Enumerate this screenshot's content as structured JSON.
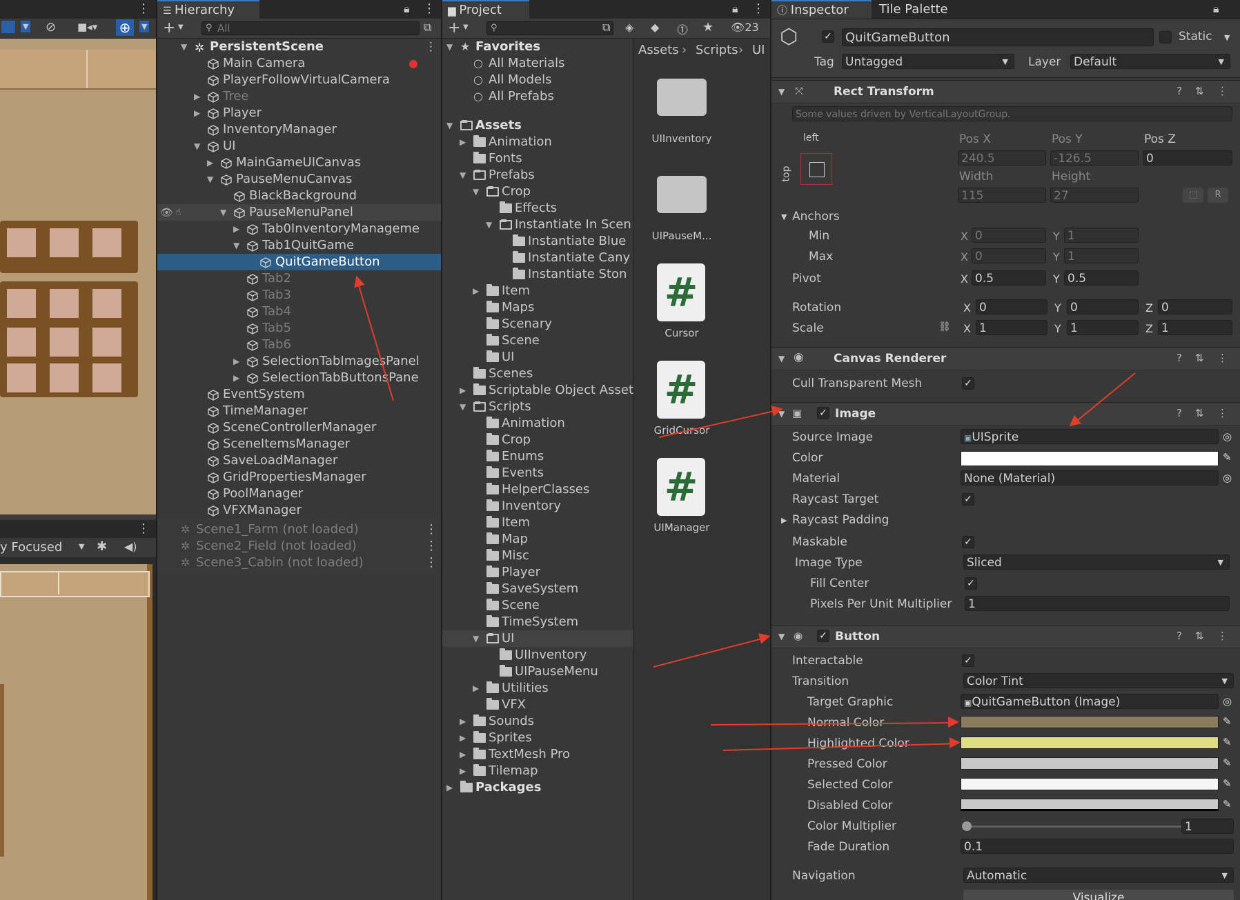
{
  "hierarchy": {
    "tab": "Hierarchy",
    "search_placeholder": "All",
    "rows": [
      {
        "label": "PersistentScene",
        "bold": true,
        "indent": 0,
        "arrow": "▼",
        "icon": "scene"
      },
      {
        "label": "Main Camera",
        "indent": 1,
        "icon": "cube"
      },
      {
        "label": "PlayerFollowVirtualCamera",
        "indent": 1,
        "icon": "cube"
      },
      {
        "label": "Tree",
        "indent": 1,
        "arrow": "▶",
        "icon": "cube",
        "dim": true
      },
      {
        "label": "Player",
        "indent": 1,
        "arrow": "▶",
        "icon": "cube"
      },
      {
        "label": "InventoryManager",
        "indent": 1,
        "icon": "cube"
      },
      {
        "label": "UI",
        "indent": 1,
        "arrow": "▼",
        "icon": "cube"
      },
      {
        "label": "MainGameUICanvas",
        "indent": 2,
        "arrow": "▶",
        "icon": "cube"
      },
      {
        "label": "PauseMenuCanvas",
        "indent": 2,
        "arrow": "▼",
        "icon": "cube"
      },
      {
        "label": "BlackBackground",
        "indent": 3,
        "icon": "cube"
      },
      {
        "label": "PauseMenuPanel",
        "indent": 3,
        "arrow": "▼",
        "icon": "cube",
        "hover": true
      },
      {
        "label": "Tab0InventoryManageme",
        "indent": 4,
        "arrow": "▶",
        "icon": "cube"
      },
      {
        "label": "Tab1QuitGame",
        "indent": 4,
        "arrow": "▼",
        "icon": "cube"
      },
      {
        "label": "QuitGameButton",
        "indent": 5,
        "icon": "cube",
        "selected": true
      },
      {
        "label": "Tab2",
        "indent": 4,
        "icon": "cube",
        "dim": true
      },
      {
        "label": "Tab3",
        "indent": 4,
        "icon": "cube",
        "dim": true
      },
      {
        "label": "Tab4",
        "indent": 4,
        "icon": "cube",
        "dim": true
      },
      {
        "label": "Tab5",
        "indent": 4,
        "icon": "cube",
        "dim": true
      },
      {
        "label": "Tab6",
        "indent": 4,
        "icon": "cube",
        "dim": true
      },
      {
        "label": "SelectionTabImagesPanel",
        "indent": 4,
        "arrow": "▶",
        "icon": "cube"
      },
      {
        "label": "SelectionTabButtonsPane",
        "indent": 4,
        "arrow": "▶",
        "icon": "cube"
      },
      {
        "label": "EventSystem",
        "indent": 1,
        "icon": "cube"
      },
      {
        "label": "TimeManager",
        "indent": 1,
        "icon": "cube"
      },
      {
        "label": "SceneControllerManager",
        "indent": 1,
        "icon": "cube"
      },
      {
        "label": "SceneItemsManager",
        "indent": 1,
        "icon": "cube"
      },
      {
        "label": "SaveLoadManager",
        "indent": 1,
        "icon": "cube"
      },
      {
        "label": "GridPropertiesManager",
        "indent": 1,
        "icon": "cube"
      },
      {
        "label": "PoolManager",
        "indent": 1,
        "icon": "cube"
      },
      {
        "label": "VFXManager",
        "indent": 1,
        "icon": "cube"
      }
    ],
    "unloaded": [
      "Scene1_Farm (not loaded)",
      "Scene2_Field (not loaded)",
      "Scene3_Cabin (not loaded)"
    ]
  },
  "game_view": {
    "focus_label": "y Focused"
  },
  "project": {
    "tab": "Project",
    "count": "23",
    "breadcrumb": [
      "Assets",
      "Scripts",
      "UI"
    ],
    "tree": [
      {
        "label": "Favorites",
        "bold": true,
        "indent": 0,
        "arrow": "▼",
        "icon": "star"
      },
      {
        "label": "All Materials",
        "indent": 1,
        "icon": "search"
      },
      {
        "label": "All Models",
        "indent": 1,
        "icon": "search"
      },
      {
        "label": "All Prefabs",
        "indent": 1,
        "icon": "search"
      },
      {
        "label": "",
        "indent": 0,
        "icon": "none"
      },
      {
        "label": "Assets",
        "bold": true,
        "indent": 0,
        "arrow": "▼",
        "icon": "folder-open"
      },
      {
        "label": "Animation",
        "indent": 1,
        "arrow": "▶",
        "icon": "folder"
      },
      {
        "label": "Fonts",
        "indent": 1,
        "icon": "folder"
      },
      {
        "label": "Prefabs",
        "indent": 1,
        "arrow": "▼",
        "icon": "folder-open"
      },
      {
        "label": "Crop",
        "indent": 2,
        "arrow": "▼",
        "icon": "folder-open"
      },
      {
        "label": "Effects",
        "indent": 3,
        "icon": "folder"
      },
      {
        "label": "Instantiate In Scen",
        "indent": 3,
        "arrow": "▼",
        "icon": "folder-open"
      },
      {
        "label": "Instantiate Blue",
        "indent": 4,
        "icon": "folder"
      },
      {
        "label": "Instantiate Cany",
        "indent": 4,
        "icon": "folder"
      },
      {
        "label": "Instantiate Ston",
        "indent": 4,
        "icon": "folder"
      },
      {
        "label": "Item",
        "indent": 2,
        "arrow": "▶",
        "icon": "folder"
      },
      {
        "label": "Maps",
        "indent": 2,
        "icon": "folder"
      },
      {
        "label": "Scenary",
        "indent": 2,
        "icon": "folder"
      },
      {
        "label": "Scene",
        "indent": 2,
        "icon": "folder"
      },
      {
        "label": "UI",
        "indent": 2,
        "icon": "folder"
      },
      {
        "label": "Scenes",
        "indent": 1,
        "icon": "folder"
      },
      {
        "label": "Scriptable Object Asset",
        "indent": 1,
        "arrow": "▶",
        "icon": "folder"
      },
      {
        "label": "Scripts",
        "indent": 1,
        "arrow": "▼",
        "icon": "folder-open"
      },
      {
        "label": "Animation",
        "indent": 2,
        "icon": "folder"
      },
      {
        "label": "Crop",
        "indent": 2,
        "icon": "folder"
      },
      {
        "label": "Enums",
        "indent": 2,
        "icon": "folder"
      },
      {
        "label": "Events",
        "indent": 2,
        "icon": "folder"
      },
      {
        "label": "HelperClasses",
        "indent": 2,
        "icon": "folder"
      },
      {
        "label": "Inventory",
        "indent": 2,
        "icon": "folder"
      },
      {
        "label": "Item",
        "indent": 2,
        "icon": "folder"
      },
      {
        "label": "Map",
        "indent": 2,
        "icon": "folder"
      },
      {
        "label": "Misc",
        "indent": 2,
        "icon": "folder"
      },
      {
        "label": "Player",
        "indent": 2,
        "icon": "folder"
      },
      {
        "label": "SaveSystem",
        "indent": 2,
        "icon": "folder"
      },
      {
        "label": "Scene",
        "indent": 2,
        "icon": "folder"
      },
      {
        "label": "TimeSystem",
        "indent": 2,
        "icon": "folder"
      },
      {
        "label": "UI",
        "indent": 2,
        "arrow": "▼",
        "icon": "folder-open",
        "hover": true
      },
      {
        "label": "UIInventory",
        "indent": 3,
        "icon": "folder"
      },
      {
        "label": "UIPauseMenu",
        "indent": 3,
        "icon": "folder"
      },
      {
        "label": "Utilities",
        "indent": 2,
        "arrow": "▶",
        "icon": "folder"
      },
      {
        "label": "VFX",
        "indent": 2,
        "icon": "folder"
      },
      {
        "label": "Sounds",
        "indent": 1,
        "arrow": "▶",
        "icon": "folder"
      },
      {
        "label": "Sprites",
        "indent": 1,
        "arrow": "▶",
        "icon": "folder"
      },
      {
        "label": "TextMesh Pro",
        "indent": 1,
        "arrow": "▶",
        "icon": "folder"
      },
      {
        "label": "Tilemap",
        "indent": 1,
        "arrow": "▶",
        "icon": "folder"
      },
      {
        "label": "Packages",
        "bold": true,
        "indent": 0,
        "arrow": "▶",
        "icon": "folder"
      }
    ],
    "assets": [
      {
        "label": "UIInventory",
        "kind": "folder"
      },
      {
        "label": "UIPauseM...",
        "kind": "folder"
      },
      {
        "label": "Cursor",
        "kind": "script"
      },
      {
        "label": "GridCursor",
        "kind": "script"
      },
      {
        "label": "UIManager",
        "kind": "script"
      }
    ]
  },
  "inspector": {
    "tab": "Inspector",
    "tab2": "Tile Palette",
    "object_name": "QuitGameButton",
    "static_label": "Static",
    "tag_label": "Tag",
    "tag_value": "Untagged",
    "layer_label": "Layer",
    "layer_value": "Default",
    "rect": {
      "title": "Rect Transform",
      "note": "Some values driven by VerticalLayoutGroup.",
      "left": "left",
      "top": "top",
      "posx_label": "Pos X",
      "posy_label": "Pos Y",
      "posz_label": "Pos Z",
      "posx": "240.5",
      "posy": "-126.5",
      "posz": "0",
      "width_label": "Width",
      "height_label": "Height",
      "width": "115",
      "height": "27",
      "anchors_label": "Anchors",
      "min_label": "Min",
      "max_label": "Max",
      "min_x": "0",
      "min_y": "1",
      "max_x": "0",
      "max_y": "1",
      "pivot_label": "Pivot",
      "pivot_x": "0.5",
      "pivot_y": "0.5",
      "rotation_label": "Rotation",
      "rot_x": "0",
      "rot_y": "0",
      "rot_z": "0",
      "scale_label": "Scale",
      "scale_x": "1",
      "scale_y": "1",
      "scale_z": "1",
      "x": "X",
      "y": "Y",
      "z": "Z",
      "r": "R"
    },
    "canvas_renderer": {
      "title": "Canvas Renderer",
      "cull_label": "Cull Transparent Mesh"
    },
    "image": {
      "title": "Image",
      "source_label": "Source Image",
      "source_value": "UISprite",
      "color_label": "Color",
      "color": "#ffffff",
      "material_label": "Material",
      "material_value": "None (Material)",
      "raycast_label": "Raycast Target",
      "padding_label": "Raycast Padding",
      "maskable_label": "Maskable",
      "type_label": "Image Type",
      "type_value": "Sliced",
      "fill_label": "Fill Center",
      "ppu_label": "Pixels Per Unit Multiplier",
      "ppu_value": "1"
    },
    "button": {
      "title": "Button",
      "interactable_label": "Interactable",
      "transition_label": "Transition",
      "transition_value": "Color Tint",
      "target_label": "Target Graphic",
      "target_value": "QuitGameButton (Image)",
      "normal_label": "Normal Color",
      "normal": "#8c7c5e",
      "highlighted_label": "Highlighted Color",
      "highlighted": "#dede84",
      "pressed_label": "Pressed Color",
      "pressed": "#c8c8c8",
      "selected_label": "Selected Color",
      "selected": "#f5f5f5",
      "disabled_label": "Disabled Color",
      "disabled": "#c8c8c8",
      "multiplier_label": "Color Multiplier",
      "multiplier_value": "1",
      "fade_label": "Fade Duration",
      "fade_value": "0.1",
      "navigation_label": "Navigation",
      "navigation_value": "Automatic",
      "visualize_label": "Visualize"
    }
  }
}
